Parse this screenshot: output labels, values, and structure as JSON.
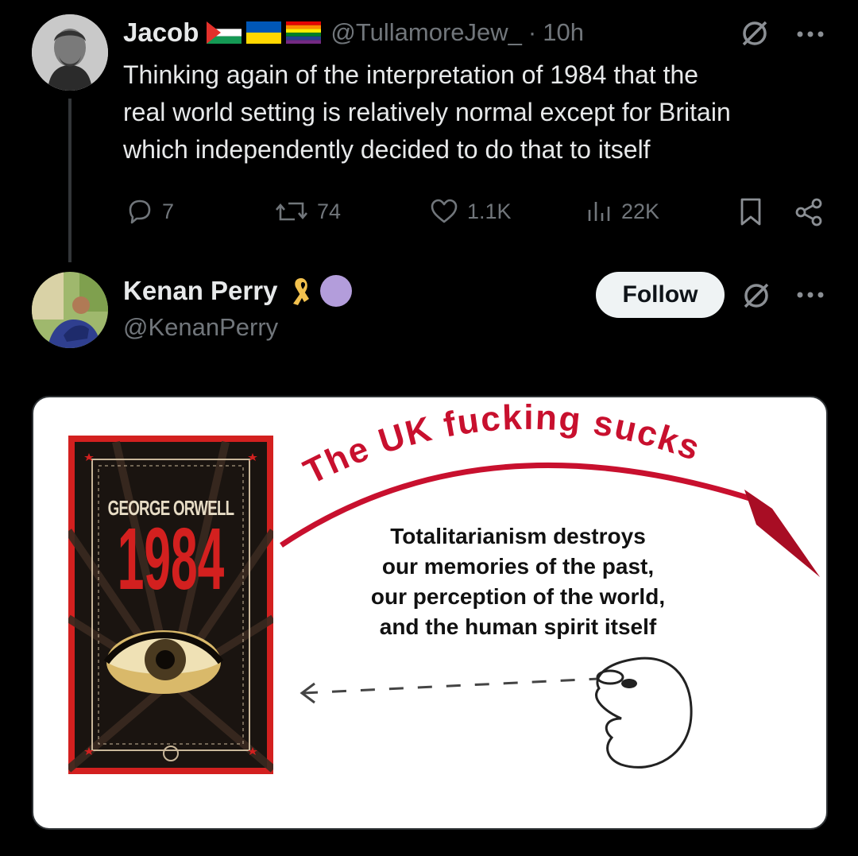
{
  "tweet1": {
    "author_name": "Jacob",
    "handle": "@TullamoreJew_",
    "separator": "·",
    "time": "10h",
    "text_lines": [
      "Thinking again of the interpretation of 1984 that the",
      "real world setting is relatively normal except for Britain",
      "which independently decided to do that to itself"
    ],
    "metrics": {
      "replies": "7",
      "reposts": "74",
      "likes": "1.1K",
      "views": "22K"
    },
    "icons": [
      "grok-icon",
      "more-icon",
      "reply-icon",
      "repost-icon",
      "like-icon",
      "views-icon",
      "bookmark-icon",
      "share-icon"
    ]
  },
  "tweet2": {
    "author_name": "Kenan Perry",
    "handle": "@KenanPerry",
    "follow_label": "Follow",
    "icons": [
      "ribbon-icon",
      "circle-badge-icon",
      "grok-icon",
      "more-icon"
    ]
  },
  "meme": {
    "book_author": "GEORGE ORWELL",
    "book_title": "1984",
    "arc_text": "The UK fucking sucks",
    "caption_lines": [
      "Totalitarianism destroys",
      "our memories of the past,",
      "our perception of the world,",
      "and the human spirit itself"
    ]
  },
  "colors": {
    "background": "#000000",
    "text": "#e7e9ea",
    "muted": "#71767b",
    "arc_red": "#c8102e",
    "badge_purple": "#b39ddb",
    "ribbon_gold": "#f2c14e"
  }
}
